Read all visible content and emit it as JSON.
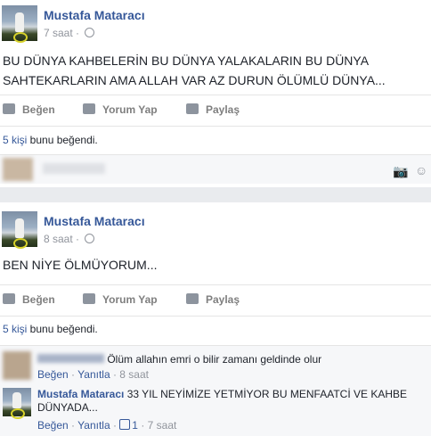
{
  "posts": [
    {
      "author": "Mustafa Mataracı",
      "time": "7 saat",
      "text": "BU DÜNYA KAHBELERİN BU DÜNYA YALAKALARIN BU DÜNYA SAHTEKARLARIN AMA ALLAH VAR AZ DURUN ÖLÜMLÜ DÜNYA...",
      "actions": {
        "like": "Beğen",
        "comment": "Yorum Yap",
        "share": "Paylaş"
      },
      "likes_count": "5 kişi",
      "likes_suffix": " bunu beğendi."
    },
    {
      "author": "Mustafa Mataracı",
      "time": "8 saat",
      "text": "BEN NİYE ÖLMÜYORUM...",
      "actions": {
        "like": "Beğen",
        "comment": "Yorum Yap",
        "share": "Paylaş"
      },
      "likes_count": "5 kişi",
      "likes_suffix": " bunu beğendi."
    }
  ],
  "comments": [
    {
      "text": "Ölüm allahın emri o bilir zamanı geldinde olur",
      "like": "Beğen",
      "reply": "Yanıtla",
      "time": "8 saat"
    },
    {
      "author": "Mustafa Mataracı",
      "text": "33 YIL NEYİMİZE YETMİYOR BU MENFAATCİ VE KAHBE DÜNYADA...",
      "like": "Beğen",
      "reply": "Yanıtla",
      "likes": "1",
      "time": "7 saat"
    }
  ],
  "icons": {
    "globe": "globe-icon",
    "camera": "camera-icon",
    "emoji": "emoji-icon",
    "like": "thumbs-up-icon",
    "comment": "comment-icon",
    "share": "share-arrow-icon"
  },
  "colors": {
    "link": "#365899",
    "muted": "#90949c",
    "bg": "#e9ebee"
  }
}
